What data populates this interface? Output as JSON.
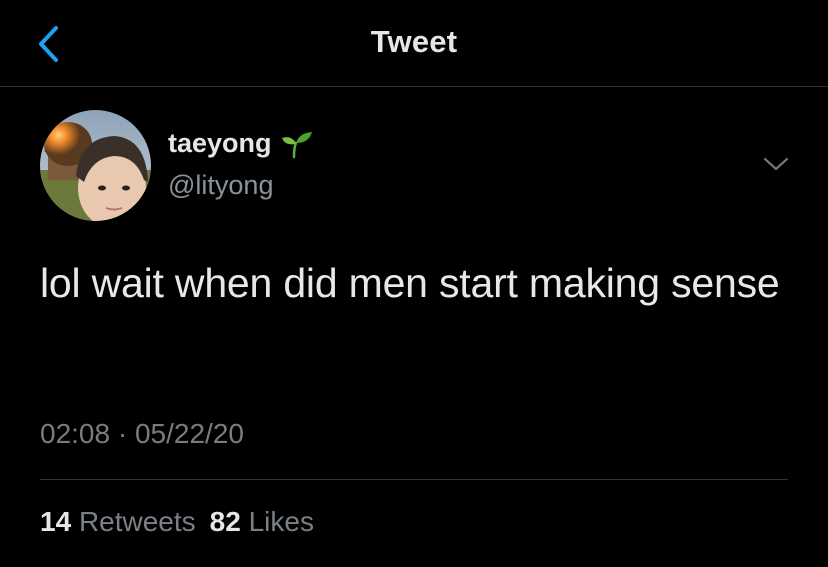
{
  "header": {
    "title": "Tweet",
    "back_icon": "chevron-left-icon",
    "accent_color": "#1da1f2"
  },
  "tweet": {
    "author": {
      "display_name": "taeyong",
      "name_emoji": "seedling-icon",
      "handle": "@lityong"
    },
    "text": "lol wait when did men start making sense",
    "time": "02:08",
    "separator": "·",
    "date": "05/22/20",
    "more_icon": "chevron-down-icon"
  },
  "stats": {
    "retweets_count": "14",
    "retweets_label": "Retweets",
    "likes_count": "82",
    "likes_label": "Likes"
  }
}
